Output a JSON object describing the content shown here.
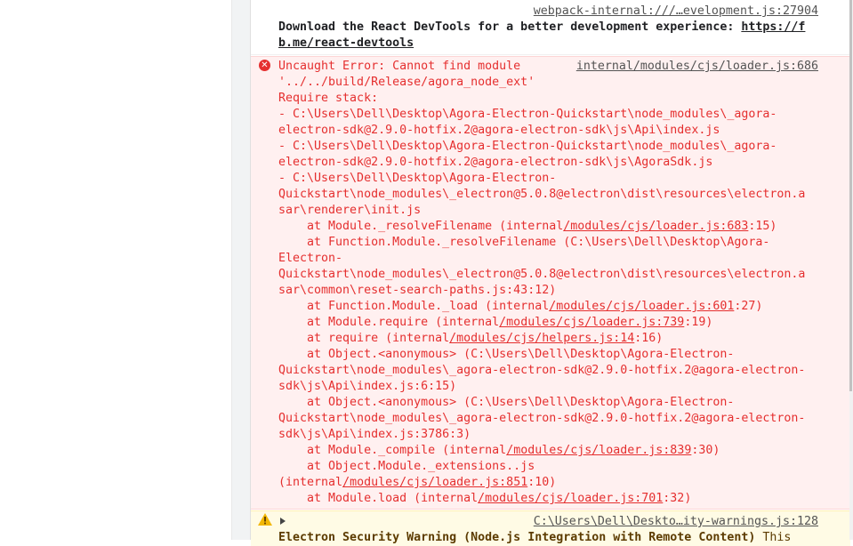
{
  "colors": {
    "error_text": "#e52f2f",
    "error_bg": "#fff0f0",
    "warn_bg": "#fffbe5",
    "link": "#545454"
  },
  "log": {
    "source": "webpack-internal:///…evelopment.js:27904",
    "line1": "Download the React DevTools for a better development experience: ",
    "link1": "https://f",
    "link2": "b.me/react-devtools"
  },
  "error": {
    "source": "internal/modules/cjs/loader.js:686",
    "lines": [
      "Uncaught Error: Cannot find module",
      "'../../build/Release/agora_node_ext'",
      "Require stack:",
      "- C:\\Users\\Dell\\Desktop\\Agora-Electron-Quickstart\\node_modules\\_agora-",
      "electron-sdk@2.9.0-hotfix.2@agora-electron-sdk\\js\\Api\\index.js",
      "- C:\\Users\\Dell\\Desktop\\Agora-Electron-Quickstart\\node_modules\\_agora-",
      "electron-sdk@2.9.0-hotfix.2@agora-electron-sdk\\js\\AgoraSdk.js",
      "- C:\\Users\\Dell\\Desktop\\Agora-Electron-",
      "Quickstart\\node_modules\\_electron@5.0.8@electron\\dist\\resources\\electron.a",
      "sar\\renderer\\init.js"
    ],
    "stack": [
      {
        "pre": "    at Module._resolveFilename (internal",
        "link": "/modules/cjs/loader.js:683",
        "post": ":15)"
      },
      {
        "pre": "    at Function.Module._resolveFilename (C:\\Users\\Dell\\Desktop\\Agora-",
        "link": "",
        "post": ""
      },
      {
        "pre": "Electron-",
        "link": "",
        "post": ""
      },
      {
        "pre": "Quickstart\\node_modules\\_electron@5.0.8@electron\\dist\\resources\\electron.a",
        "link": "",
        "post": ""
      },
      {
        "pre": "sar\\common\\reset-search-paths.js:43:12)",
        "link": "",
        "post": ""
      },
      {
        "pre": "    at Function.Module._load (internal",
        "link": "/modules/cjs/loader.js:601",
        "post": ":27)"
      },
      {
        "pre": "    at Module.require (internal",
        "link": "/modules/cjs/loader.js:739",
        "post": ":19)"
      },
      {
        "pre": "    at require (internal",
        "link": "/modules/cjs/helpers.js:14",
        "post": ":16)"
      },
      {
        "pre": "    at Object.<anonymous> (C:\\Users\\Dell\\Desktop\\Agora-Electron-",
        "link": "",
        "post": ""
      },
      {
        "pre": "Quickstart\\node_modules\\_agora-electron-sdk@2.9.0-hotfix.2@agora-electron-",
        "link": "",
        "post": ""
      },
      {
        "pre": "sdk\\js\\Api\\index.js:6:15)",
        "link": "",
        "post": ""
      },
      {
        "pre": "    at Object.<anonymous> (C:\\Users\\Dell\\Desktop\\Agora-Electron-",
        "link": "",
        "post": ""
      },
      {
        "pre": "Quickstart\\node_modules\\_agora-electron-sdk@2.9.0-hotfix.2@agora-electron-",
        "link": "",
        "post": ""
      },
      {
        "pre": "sdk\\js\\Api\\index.js:3786:3)",
        "link": "",
        "post": ""
      },
      {
        "pre": "    at Module._compile (internal",
        "link": "/modules/cjs/loader.js:839",
        "post": ":30)"
      },
      {
        "pre": "    at Object.Module._extensions..js",
        "link": "",
        "post": ""
      },
      {
        "pre": "(internal",
        "link": "/modules/cjs/loader.js:851",
        "post": ":10)"
      },
      {
        "pre": "    at Module.load (internal",
        "link": "/modules/cjs/loader.js:701",
        "post": ":32)"
      }
    ]
  },
  "warning": {
    "source": "C:\\Users\\Dell\\Deskto…ity-warnings.js:128",
    "text": "Electron Security Warning (Node.js Integration with Remote Content)",
    "text_tail": " This"
  }
}
